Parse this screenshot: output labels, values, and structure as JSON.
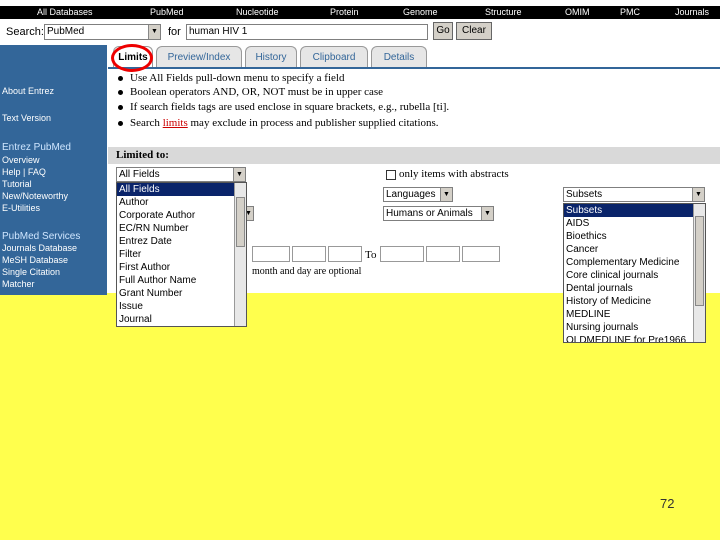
{
  "topnav": [
    "All Databases",
    "PubMed",
    "Nucleotide",
    "Protein",
    "Genome",
    "Structure",
    "OMIM",
    "PMC",
    "Journals"
  ],
  "search": {
    "label": "Search:",
    "db": "PubMed",
    "for_label": "for",
    "query": "human HIV 1",
    "go": "Go",
    "clear": "Clear"
  },
  "tabs": [
    "Limits",
    "Preview/Index",
    "History",
    "Clipboard",
    "Details"
  ],
  "sidebar": {
    "about": "About Entrez",
    "text": "Text Version",
    "section1": "Entrez PubMed",
    "items1": [
      "Overview",
      "Help | FAQ",
      "Tutorial",
      "New/Noteworthy",
      "E-Utilities"
    ],
    "section2": "PubMed Services",
    "items2": [
      "Journals Database",
      "MeSH Database",
      "Single Citation",
      "Matcher"
    ]
  },
  "bullets": [
    "Use All Fields pull-down menu to specify a field",
    "Boolean operators AND, OR, NOT must be in upper case",
    "If search fields tags are used enclose in square brackets, e.g., rubella [ti].",
    "Search limits may exclude in process and publisher supplied citations."
  ],
  "bullet4_parts": {
    "before": "Search ",
    "link": "limits",
    "after": " may exclude in process and publisher supplied citations."
  },
  "limited_to": "Limited to:",
  "fields_select": "All Fields",
  "fields_options": [
    "All Fields",
    "Author",
    "Corporate Author",
    "EC/RN Number",
    "Entrez Date",
    "Filter",
    "First Author",
    "Full Author Name",
    "Grant Number",
    "Issue",
    "Journal"
  ],
  "abstracts_label": "only items with abstracts",
  "languages": "Languages",
  "humans": "Humans or Animals",
  "subsets_select": "Subsets",
  "subsets_options": [
    "Subsets",
    "AIDS",
    "Bioethics",
    "Cancer",
    "Complementary Medicine",
    "Core clinical journals",
    "Dental journals",
    "History of Medicine",
    "MEDLINE",
    "Nursing journals",
    "OLDMEDLINE for Pre1966"
  ],
  "to_label": "To",
  "date_note": "month and day are optional",
  "page_number": "72"
}
